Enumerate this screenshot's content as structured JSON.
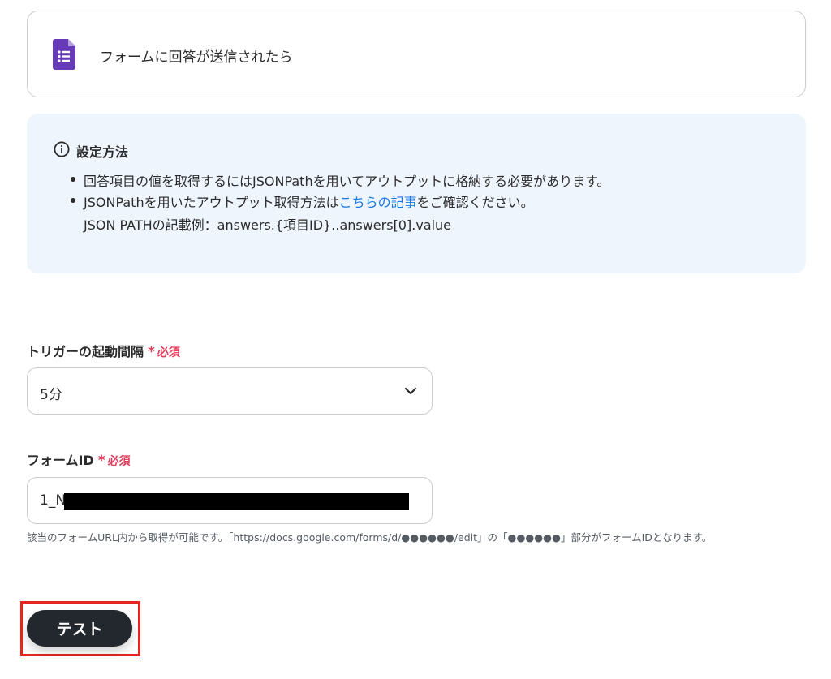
{
  "trigger": {
    "icon": "google-forms-icon",
    "label": "フォームに回答が送信されたら"
  },
  "info": {
    "icon": "info-icon",
    "title": "設定方法",
    "bullet1": "回答項目の値を取得するにはJSONPathを用いてアウトプットに格納する必要があります。",
    "bullet2_prefix": "JSONPathを用いたアウトプット取得方法は",
    "bullet2_link": "こちらの記事",
    "bullet2_suffix": "をご確認ください。",
    "example": "JSON PATHの記載例：answers.{項目ID}..answers[0].value"
  },
  "interval_field": {
    "label": "トリガーの起動間隔",
    "required_star": "*",
    "required_text": "必須",
    "value": "5分",
    "icon": "chevron-down-icon"
  },
  "form_id_field": {
    "label": "フォームID",
    "required_star": "*",
    "required_text": "必須",
    "value": "1_N",
    "helper": "該当のフォームURL内から取得が可能です。「https://docs.google.com/forms/d/●●●●●●/edit」の「●●●●●●」部分がフォームIDとなります。"
  },
  "actions": {
    "test_label": "テスト"
  },
  "colors": {
    "accent_link": "#1a7ae0",
    "required": "#e0405e",
    "forms_purple": "#673ab7",
    "button_dark": "#23282e",
    "highlight": "#e52520",
    "info_bg": "#eef5fd"
  }
}
